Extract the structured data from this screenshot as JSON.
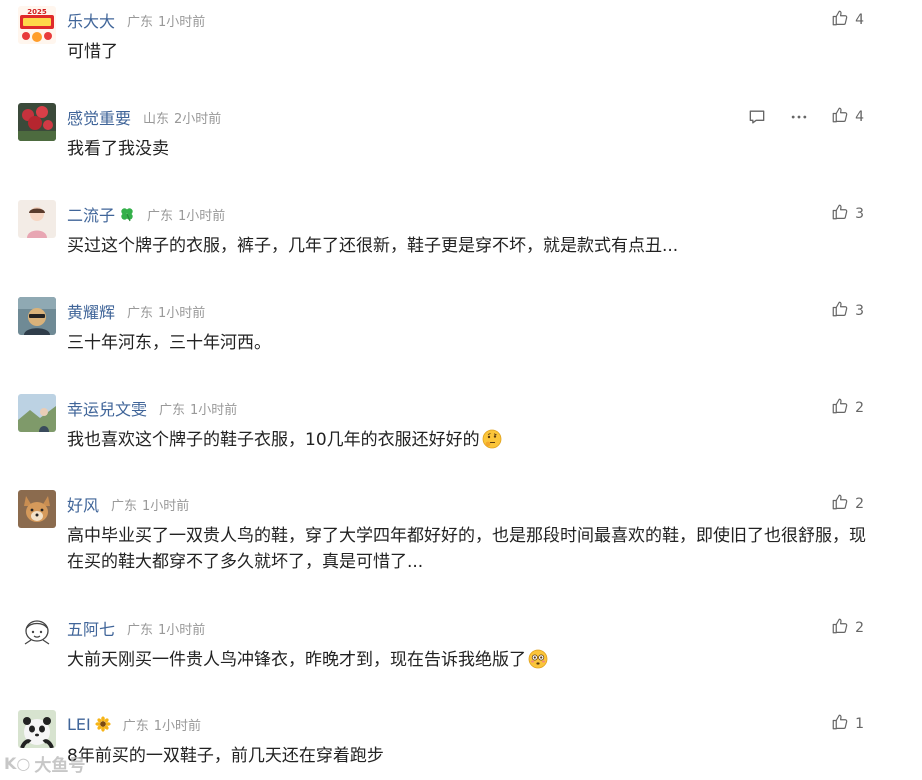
{
  "comments": [
    {
      "username": "乐大大",
      "location": "广东",
      "time": "1小时前",
      "text": "可惜了",
      "likes": "4",
      "avatar_text": "2025"
    },
    {
      "username": "感觉重要",
      "location": "山东",
      "time": "2小时前",
      "text": "我看了我没卖",
      "likes": "4"
    },
    {
      "username": "二流子",
      "location": "广东",
      "time": "1小时前",
      "text": "买过这个牌子的衣服，裤子，几年了还很新，鞋子更是穿不坏，就是款式有点丑...",
      "likes": "3"
    },
    {
      "username": "黄耀辉",
      "location": "广东",
      "time": "1小时前",
      "text": "三十年河东，三十年河西。",
      "likes": "3"
    },
    {
      "username": "幸运兒文雯",
      "location": "广东",
      "time": "1小时前",
      "text": "我也喜欢这个牌子的鞋子衣服，10几年的衣服还好好的",
      "likes": "2"
    },
    {
      "username": "好风",
      "location": "广东",
      "time": "1小时前",
      "text": "高中毕业买了一双贵人鸟的鞋，穿了大学四年都好好的，也是那段时间最喜欢的鞋，即使旧了也很舒服，现在买的鞋大都穿不了多久就坏了，真是可惜了...",
      "likes": "2"
    },
    {
      "username": "五阿七",
      "location": "广东",
      "time": "1小时前",
      "text": "大前天刚买一件贵人鸟冲锋衣，昨晚才到，现在告诉我绝版了",
      "likes": "2"
    },
    {
      "username": "LEI",
      "location": "广东",
      "time": "1小时前",
      "text": "8年前买的一双鞋子，前几天还在穿着跑步",
      "likes": "1"
    }
  ],
  "watermark": {
    "logo": "K○",
    "text": "大鱼号"
  }
}
